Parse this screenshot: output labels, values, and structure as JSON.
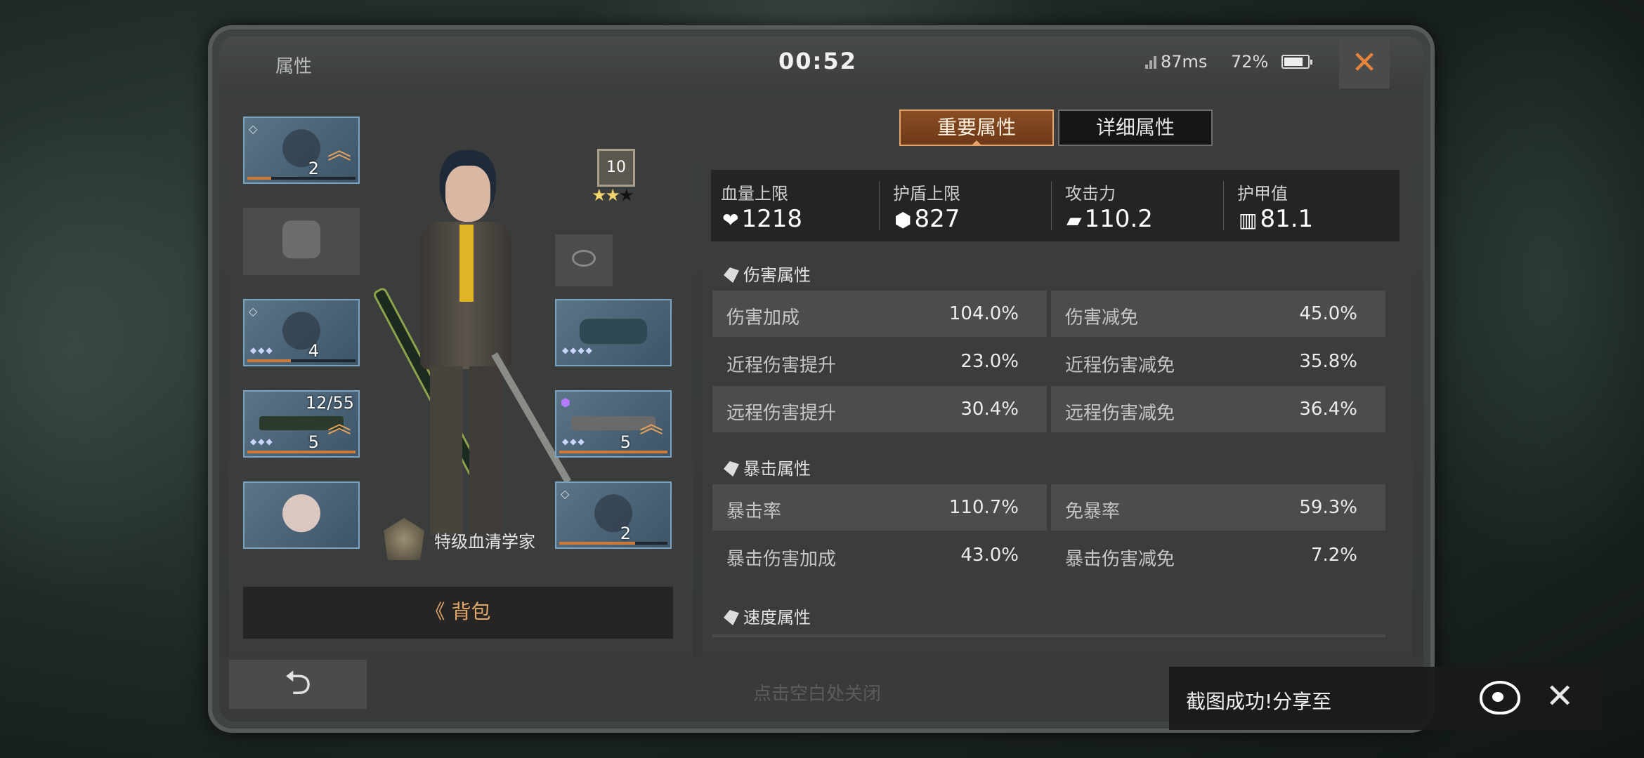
{
  "header": {
    "title": "属性",
    "timer": "00:52",
    "ping": "87ms",
    "battery": "72%",
    "close_glyph": "✕"
  },
  "left": {
    "slots": {
      "helmet_level": "2",
      "armor_level": "4",
      "weapon_ammo": "12/55",
      "weapon_level": "5",
      "melee_level": "5",
      "gloves_level": "2"
    },
    "rank_level": "10",
    "rank_stars_filled": 2,
    "rank_stars_total": 3,
    "title_name": "特级血清学家",
    "backpack_label": "背包",
    "backpack_arrow": "《"
  },
  "tabs": {
    "primary": "重要属性",
    "detailed": "详细属性"
  },
  "main_stats": [
    {
      "label": "血量上限",
      "icon": "heart-icon",
      "glyph": "❤",
      "value": "1218"
    },
    {
      "label": "护盾上限",
      "icon": "shield-icon",
      "glyph": "⬢",
      "value": "827"
    },
    {
      "label": "攻击力",
      "icon": "gun-icon",
      "glyph": "▰",
      "value": "110.2"
    },
    {
      "label": "护甲值",
      "icon": "armor-icon",
      "glyph": "▥",
      "value": "81.1"
    }
  ],
  "sections": {
    "damage": {
      "title": "伤害属性",
      "rows": [
        {
          "k1": "伤害加成",
          "v1": "104.0%",
          "k2": "伤害减免",
          "v2": "45.0%"
        },
        {
          "k1": "近程伤害提升",
          "v1": "23.0%",
          "k2": "近程伤害减免",
          "v2": "35.8%"
        },
        {
          "k1": "远程伤害提升",
          "v1": "30.4%",
          "k2": "远程伤害减免",
          "v2": "36.4%"
        }
      ]
    },
    "crit": {
      "title": "暴击属性",
      "rows": [
        {
          "k1": "暴击率",
          "v1": "110.7%",
          "k2": "免暴率",
          "v2": "59.3%"
        },
        {
          "k1": "暴击伤害加成",
          "v1": "43.0%",
          "k2": "暴击伤害减免",
          "v2": "7.2%"
        }
      ]
    },
    "speed": {
      "title": "速度属性"
    }
  },
  "footer": {
    "back_glyph": "⮌",
    "close_hint": "点击空白处关闭"
  },
  "toast": {
    "message": "截图成功!分享至",
    "close_glyph": "✕"
  },
  "colors": {
    "accent": "#e4a46a",
    "close": "#e8843a",
    "slot_border": "#7aa4c2"
  }
}
